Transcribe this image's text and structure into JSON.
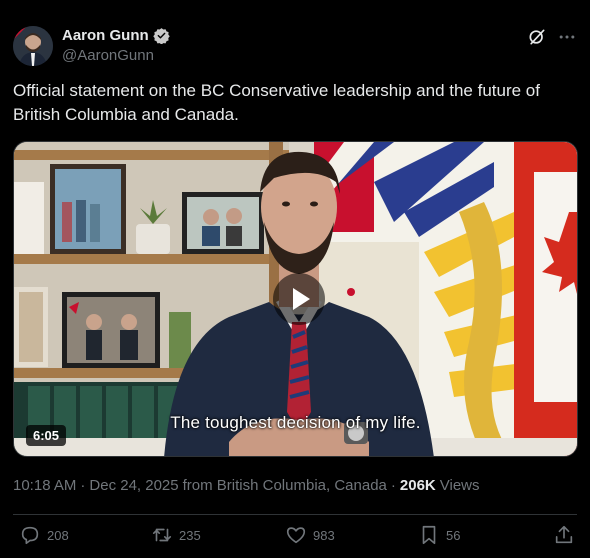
{
  "author": {
    "name": "Aaron Gunn",
    "handle": "@AaronGunn",
    "verified": true
  },
  "tweet": {
    "text": "Official statement on the BC Conservative leadership and the future of British Columbia and Canada."
  },
  "video": {
    "caption": "The toughest decision of my life.",
    "duration": "6:05"
  },
  "meta": {
    "time": "10:18 AM",
    "date": "Dec 24, 2025",
    "location": "from British Columbia, Canada",
    "views_count": "206K",
    "views_label": "Views"
  },
  "actions": {
    "replies": "208",
    "reposts": "235",
    "likes": "983",
    "bookmarks": "56"
  },
  "colors": {
    "background": "#000000",
    "text": "#e7e9ea",
    "muted": "#71767b",
    "verified": "#c9c9c9",
    "divider": "#2f3336"
  },
  "icons": [
    "verified-badge-icon",
    "grok-icon",
    "more-icon",
    "play-icon",
    "reply-icon",
    "repost-icon",
    "like-icon",
    "bookmark-icon",
    "share-icon"
  ]
}
